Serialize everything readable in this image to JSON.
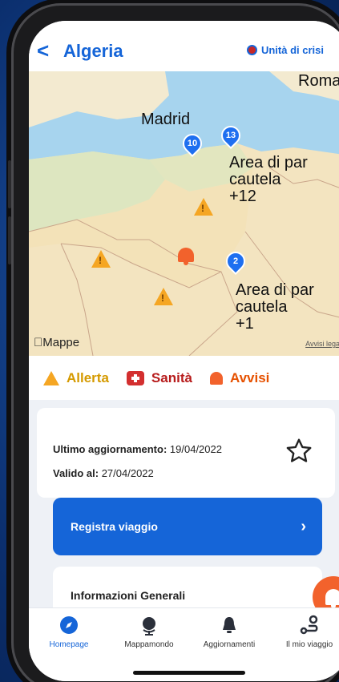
{
  "header": {
    "back_label": "<",
    "title": "Algeria",
    "crisis_label": "Unità di crisi"
  },
  "map": {
    "labels": {
      "madrid": "Madrid",
      "roma": "Roma",
      "area1_line1": "Area di par",
      "area1_line2": "cautela",
      "area1_line3": "+12",
      "area2_line1": "Area di par",
      "area2_line2": "cautela",
      "area2_line3": "+1"
    },
    "pins": {
      "pin_10": "10",
      "pin_13": "13",
      "pin_2": "2"
    },
    "attribution": "Mappe",
    "legal": "Avvisi legali"
  },
  "legend": {
    "alert": "Allerta",
    "health": "Sanità",
    "notices": "Avvisi",
    "colors": {
      "alert": "#d59a00",
      "health": "#b71c1c",
      "notices": "#e65100"
    }
  },
  "info": {
    "updated_label": "Ultimo aggiornamento:",
    "updated_value": "19/04/2022",
    "valid_label": "Valido al:",
    "valid_value": "27/04/2022"
  },
  "actions": {
    "register_label": "Registra viaggio",
    "general_info_label": "Informazioni Generali"
  },
  "tabs": [
    {
      "label": "Homepage",
      "icon": "compass-icon"
    },
    {
      "label": "Mappamondo",
      "icon": "globe-icon"
    },
    {
      "label": "Aggiornamenti",
      "icon": "bell-icon"
    },
    {
      "label": "Il mio viaggio",
      "icon": "route-icon"
    }
  ],
  "colors": {
    "accent": "#1565d8",
    "fab": "#f2622c"
  }
}
